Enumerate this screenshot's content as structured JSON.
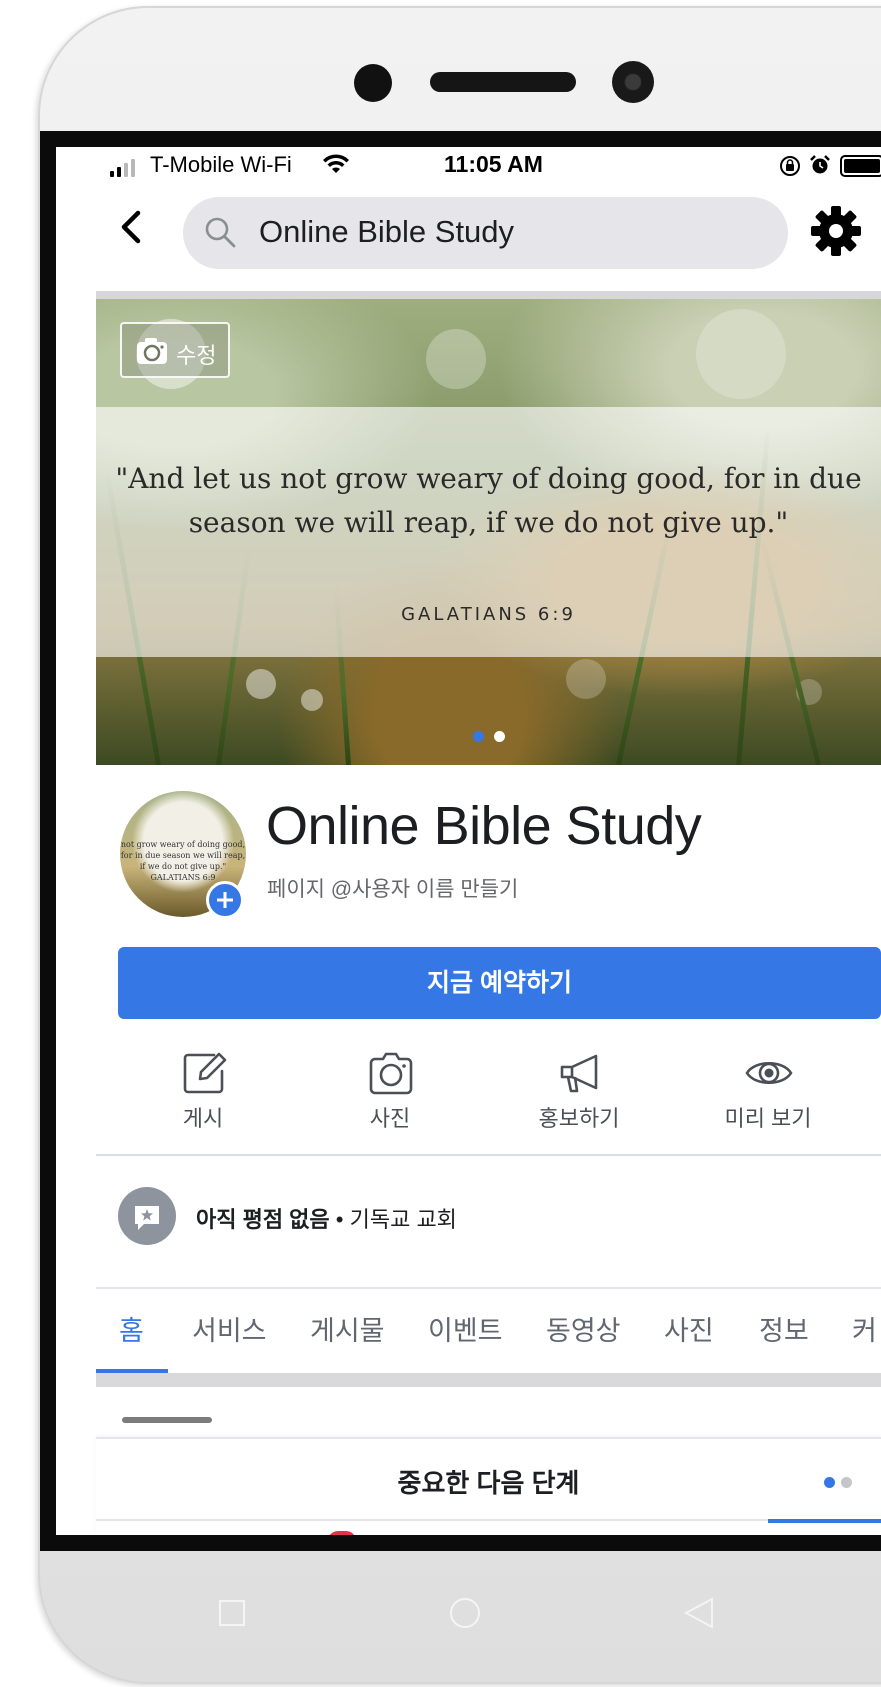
{
  "status_bar": {
    "carrier": "T-Mobile Wi-Fi",
    "time": "11:05 AM",
    "signal_bars_on": 2,
    "signal_bars_total": 4
  },
  "header": {
    "search_text": "Online Bible Study",
    "back_icon": "chevron-left-icon",
    "settings_icon": "gear-icon"
  },
  "cover": {
    "edit_label": "수정",
    "quote": "\"And let us not grow weary of doing good, for in due season we will reap, if we do not give up.\"",
    "reference": "GALATIANS 6:9",
    "slides_total": 2,
    "active_slide": 1
  },
  "profile": {
    "name": "Online Bible Study",
    "subtitle": "페이지 @사용자 이름 만들기",
    "avatar_text": "not grow weary of doing good, for in due season we will reap, if we do not give up.\" GALATIANS 6:9"
  },
  "cta": {
    "label": "지금 예약하기"
  },
  "actions": [
    {
      "label": "게시",
      "icon": "edit-icon"
    },
    {
      "label": "사진",
      "icon": "camera-icon"
    },
    {
      "label": "홍보하기",
      "icon": "megaphone-icon"
    },
    {
      "label": "미리 보기",
      "icon": "eye-icon"
    }
  ],
  "rating": {
    "bold": "아직 평점 없음",
    "separator": " • ",
    "category": "기독교 교회"
  },
  "tabs": [
    "홈",
    "서비스",
    "게시물",
    "이벤트",
    "동영상",
    "사진",
    "정보",
    "커"
  ],
  "active_tab": "홈",
  "sheet": {
    "title": "중요한 다음 단계",
    "pages_total": 2,
    "active_page": 1
  },
  "colors": {
    "accent": "#3578e5",
    "text_primary": "#1c1e21",
    "text_secondary": "#65676b",
    "search_bg": "#e6e6ea"
  }
}
